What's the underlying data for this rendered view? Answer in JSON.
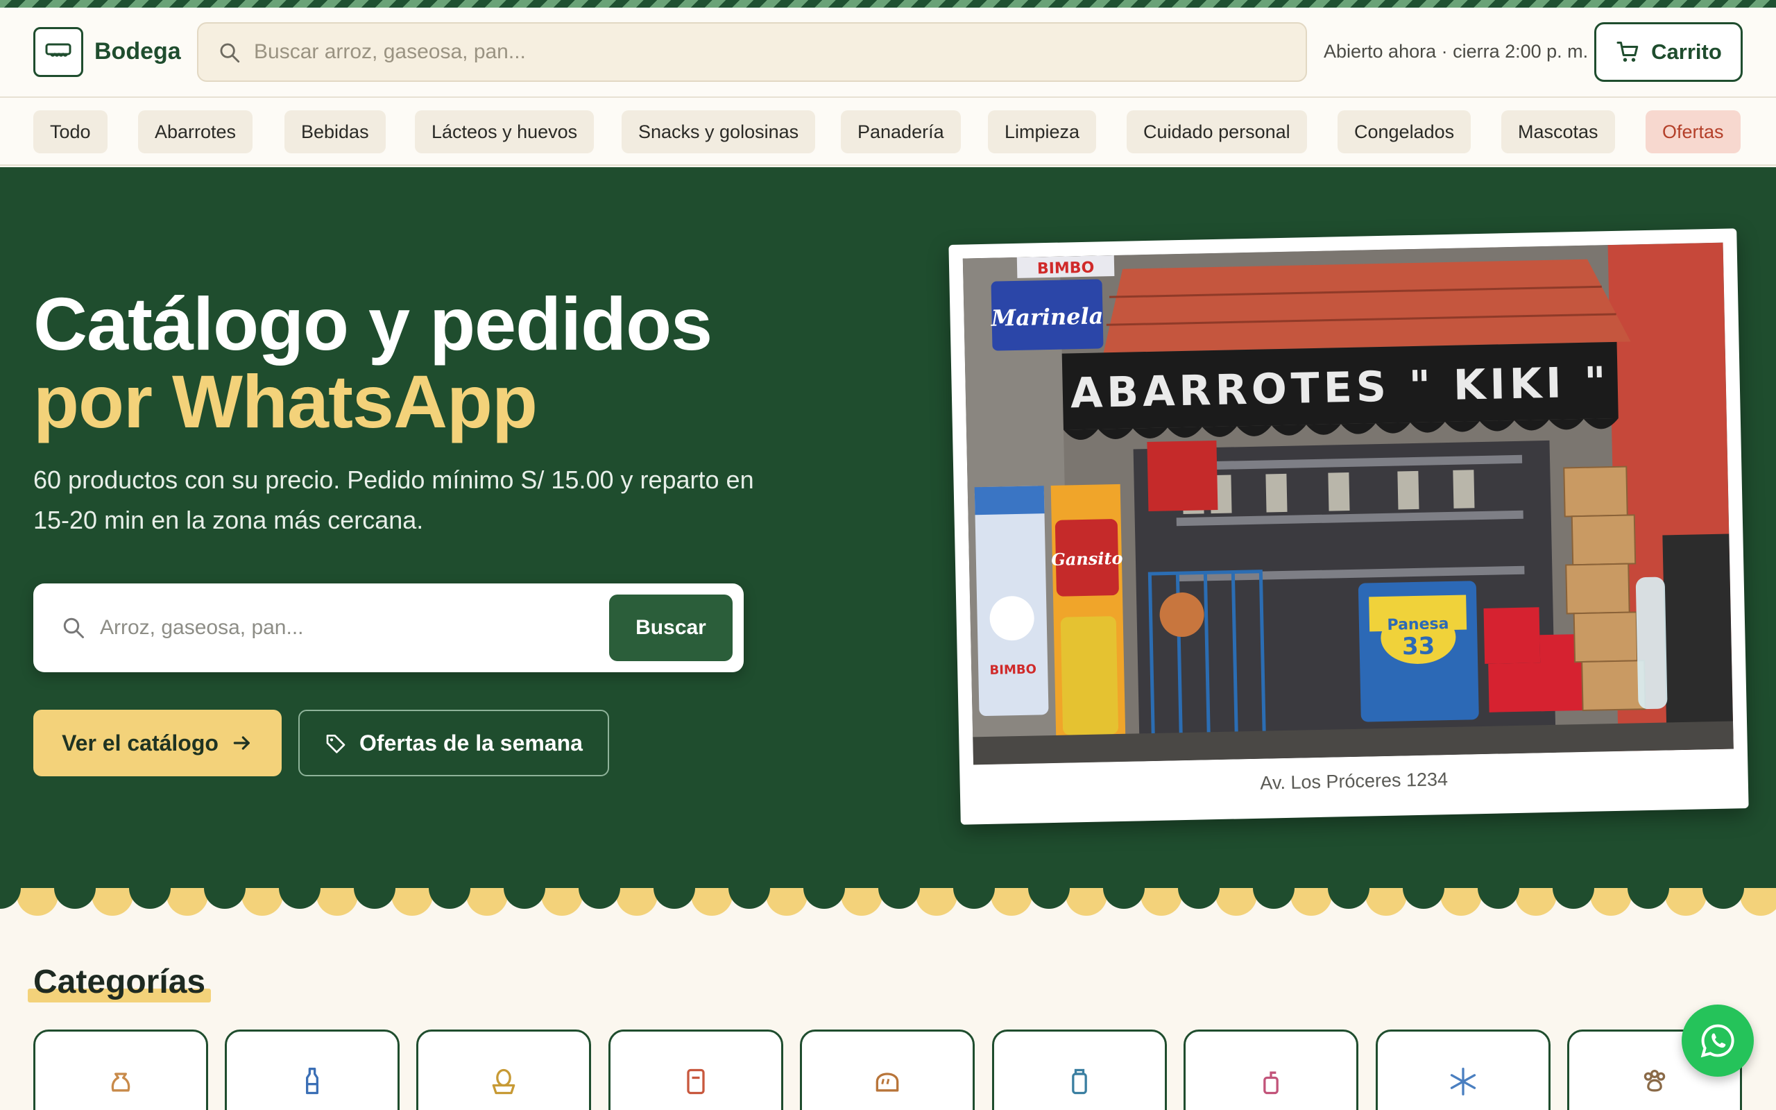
{
  "header": {
    "brand": "Bodega",
    "search_placeholder": "Buscar arroz, gaseosa, pan...",
    "status": "Abierto ahora · cierra 2:00 p. m.",
    "cart_label": "Carrito"
  },
  "nav": {
    "categories": [
      "Todo",
      "Abarrotes",
      "Bebidas",
      "Lácteos y huevos",
      "Snacks y golosinas",
      "Panadería",
      "Limpieza",
      "Cuidado personal",
      "Congelados",
      "Mascotas",
      "Ofertas"
    ]
  },
  "hero": {
    "title_line1": "Catálogo y pedidos",
    "title_line2": "por WhatsApp",
    "subtitle": "60 productos con su precio. Pedido mínimo S/ 15.00 y reparto en 15-20 min en la zona más cercana.",
    "search_placeholder": "Arroz, gaseosa, pan...",
    "search_button": "Buscar",
    "catalog_button": "Ver el catálogo",
    "offers_button": "Ofertas de la semana",
    "photo_caption": "Av. Los Próceres 1234",
    "photo_signs": {
      "sign_main": "ABARROTES \" KIKI \"",
      "sign_top": "BIMBO",
      "sign_marinela": "Marinela",
      "sign_gansito": "Gansito",
      "sign_panesa": "Panesa",
      "sign_panesa_num": "33",
      "sign_bimbo_bag": "BIMBO"
    }
  },
  "categories": {
    "title": "Categorías",
    "icons": [
      "sack-icon",
      "bottle-icon",
      "egg-icon",
      "snack-jar-icon",
      "bread-icon",
      "detergent-icon",
      "soap-dispenser-icon",
      "snowflake-icon",
      "paw-icon"
    ]
  },
  "colors": {
    "primary": "#1f4d2e",
    "accent": "#f3d27a",
    "offer": "#b4402a",
    "whatsapp": "#25c35a"
  }
}
